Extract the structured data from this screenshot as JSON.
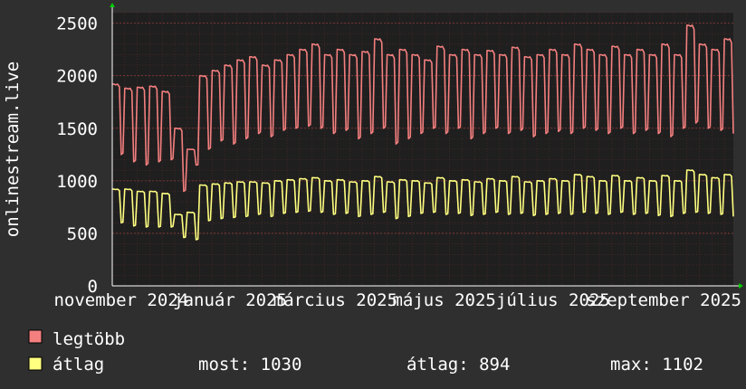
{
  "chart_data": {
    "type": "line",
    "ylabel": "onlinestream.live",
    "ylim": [
      0,
      2600
    ],
    "yticks": [
      0,
      500,
      1000,
      1500,
      2000,
      2500
    ],
    "x_range": [
      "2024-10-27",
      "2025-10-10"
    ],
    "x_ticks": [
      {
        "date": "2024-11-01",
        "label": "november 2024"
      },
      {
        "date": "2025-01-01",
        "label": "január 2025"
      },
      {
        "date": "2025-03-01",
        "label": "március 2025"
      },
      {
        "date": "2025-05-01",
        "label": "május 2025"
      },
      {
        "date": "2025-07-01",
        "label": "július 2025"
      },
      {
        "date": "2025-09-01",
        "label": "szeptember 2025"
      }
    ],
    "grid": true,
    "series": [
      {
        "name": "legtöbb",
        "color": "#f47f7f",
        "weekly_peaks": [
          1920,
          1880,
          1890,
          1900,
          1850,
          1500,
          1300,
          2000,
          2050,
          2100,
          2150,
          2180,
          2100,
          2150,
          2200,
          2250,
          2300,
          2200,
          2250,
          2200,
          2230,
          2350,
          2200,
          2250,
          2200,
          2150,
          2280,
          2200,
          2250,
          2200,
          2240,
          2200,
          2270,
          2180,
          2200,
          2250,
          2200,
          2300,
          2250,
          2200,
          2280,
          2200,
          2250,
          2200,
          2300,
          2200,
          2480,
          2300,
          2250,
          2350,
          2280,
          2200,
          2300,
          2200,
          2200,
          2200
        ],
        "weekly_troughs": [
          1250,
          1180,
          1150,
          1180,
          1200,
          900,
          1150,
          1300,
          1380,
          1350,
          1400,
          1450,
          1420,
          1480,
          1500,
          1520,
          1500,
          1450,
          1480,
          1400,
          1450,
          1500,
          1350,
          1400,
          1450,
          1500,
          1450,
          1500,
          1400,
          1450,
          1500,
          1450,
          1480,
          1420,
          1450,
          1470,
          1450,
          1500,
          1480,
          1450,
          1500,
          1450,
          1480,
          1450,
          1420,
          1500,
          1550,
          1500,
          1480,
          1450,
          1500,
          1480,
          1450,
          1430,
          1420,
          1450
        ]
      },
      {
        "name": "átlag",
        "color": "#ffff80",
        "weekly_peaks": [
          920,
          920,
          900,
          900,
          880,
          680,
          700,
          960,
          970,
          980,
          990,
          990,
          980,
          1000,
          1010,
          1020,
          1030,
          1000,
          1010,
          990,
          1000,
          1040,
          990,
          1010,
          1000,
          980,
          1030,
          1000,
          1010,
          990,
          1020,
          1000,
          1040,
          990,
          1000,
          1020,
          1000,
          1060,
          1040,
          1000,
          1050,
          1000,
          1030,
          1000,
          1050,
          1000,
          1102,
          1060,
          1030,
          1060,
          1040,
          1000,
          1050,
          1000,
          1020,
          1030
        ],
        "weekly_troughs": [
          600,
          570,
          560,
          560,
          560,
          460,
          440,
          620,
          640,
          650,
          660,
          680,
          660,
          690,
          700,
          710,
          700,
          680,
          690,
          660,
          680,
          700,
          640,
          660,
          690,
          700,
          680,
          690,
          670,
          680,
          700,
          680,
          690,
          670,
          680,
          690,
          680,
          700,
          690,
          680,
          700,
          680,
          690,
          670,
          660,
          690,
          700,
          690,
          680,
          660,
          690,
          680,
          660,
          650,
          640,
          650
        ]
      }
    ]
  },
  "legend": {
    "items": [
      {
        "label": "legtöbb",
        "color": "#f47f7f"
      },
      {
        "label": "átlag",
        "color": "#ffff80"
      }
    ],
    "stats": {
      "most": "most: 1030",
      "atlag": "átlag: 894",
      "max": "max: 1102"
    }
  }
}
